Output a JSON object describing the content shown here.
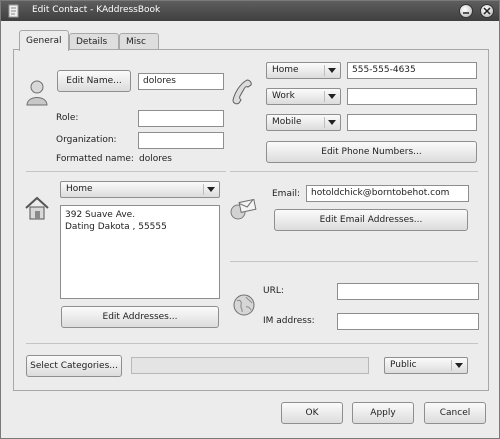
{
  "window": {
    "title": "Edit Contact - KAddressBook"
  },
  "tabs": [
    {
      "label": "General"
    },
    {
      "label": "Details"
    },
    {
      "label": "Misc"
    }
  ],
  "name": {
    "edit_name_button": "Edit Name...",
    "name_value": "dolores",
    "role_label": "Role:",
    "role_value": "",
    "organization_label": "Organization:",
    "organization_value": "",
    "formatted_name_label": "Formatted name:",
    "formatted_name_value": "dolores"
  },
  "phones": {
    "rows": [
      {
        "type": "Home",
        "number": "555-555-4635"
      },
      {
        "type": "Work",
        "number": ""
      },
      {
        "type": "Mobile",
        "number": ""
      }
    ],
    "edit_button": "Edit Phone Numbers..."
  },
  "address": {
    "type": "Home",
    "lines": [
      "392 Suave Ave.",
      "Dating Dakota , 55555"
    ],
    "edit_button": "Edit Addresses..."
  },
  "email": {
    "label": "Email:",
    "value": "hotoldchick@borntobehot.com",
    "edit_button": "Edit Email Addresses..."
  },
  "web": {
    "url_label": "URL:",
    "url_value": "",
    "im_label": "IM address:",
    "im_value": ""
  },
  "categories": {
    "button": "Select Categories...",
    "value": "",
    "privacy": "Public"
  },
  "footer": {
    "ok": "OK",
    "apply": "Apply",
    "cancel": "Cancel"
  },
  "icons": {
    "app": "kaddressbook-icon",
    "person": "person-icon",
    "phone": "phone-icon",
    "home": "home-icon",
    "email": "envelope-icon",
    "web": "globe-icon"
  }
}
